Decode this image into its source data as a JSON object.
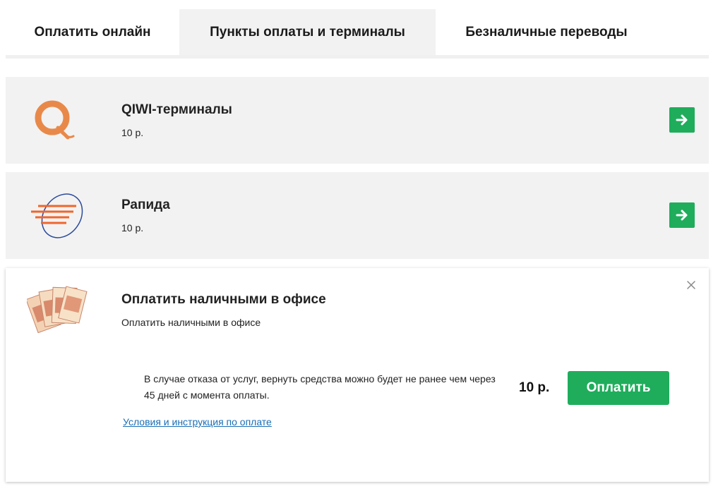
{
  "tabs": [
    {
      "label": "Оплатить онлайн",
      "active": false
    },
    {
      "label": "Пункты оплаты и терминалы",
      "active": true
    },
    {
      "label": "Безналичные переводы",
      "active": false
    }
  ],
  "methods": [
    {
      "title": "QIWI-терминалы",
      "price": "10 р.",
      "icon": "qiwi-logo-icon"
    },
    {
      "title": "Рапида",
      "price": "10 р.",
      "icon": "rapida-logo-icon"
    }
  ],
  "office": {
    "title": "Оплатить наличными в офисе",
    "subtitle": "Оплатить наличными в офисе",
    "notice": "В случае отказа от услуг, вернуть средства можно будет не ранее чем через 45 дней с момента оплаты.",
    "amount": "10 р.",
    "pay_label": "Оплатить",
    "terms_link": "Условия и инструкция по оплате",
    "icon": "cash-banknotes-icon"
  },
  "colors": {
    "accent_green": "#1fad5c",
    "link_blue": "#1a6fb5",
    "qiwi_orange": "#e8894a",
    "rapida_orange": "#f0652c",
    "rapida_blue": "#2a4a9c",
    "card_bg": "#f2f2f2"
  }
}
